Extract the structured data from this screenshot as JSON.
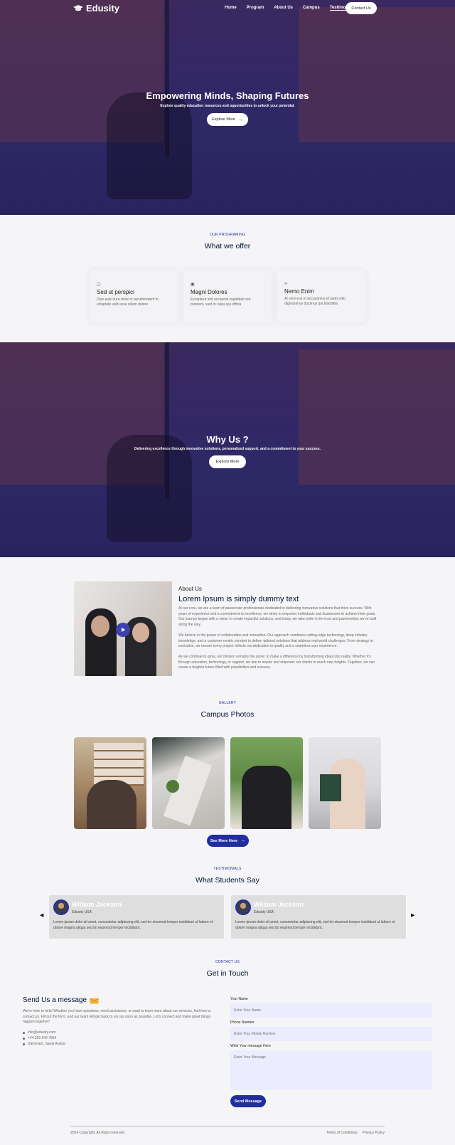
{
  "brand": {
    "name": "Edusity"
  },
  "nav": {
    "links": [
      "Home",
      "Program",
      "About Us",
      "Campus",
      "Testimonial"
    ],
    "contact_button": "Contact Us"
  },
  "hero": {
    "title": "Empowering Minds, Shaping Futures",
    "subtitle": "Explore quality education resources and opportunities to unlock your potential.",
    "button": "Explore More"
  },
  "programs": {
    "tag": "OUR PROGRAMING",
    "title": "What we offer",
    "cards": [
      {
        "icon": "grid-icon",
        "title": "Sed ut perspici",
        "text": "Duis aute irure dolor in reprehenderit in voluptate velit esse cillum dolore"
      },
      {
        "icon": "image-icon",
        "title": "Magni Dolores",
        "text": "Excepteur sint occaecat cupidatat non proident, sunt in culpa qui officia"
      },
      {
        "icon": "link-icon",
        "title": "Nemo Enim",
        "text": "At vero eos et accusamus et iusto odio dignissimos ducimus qui blanditiis"
      }
    ]
  },
  "why": {
    "title": "Why Us ?",
    "subtitle": "Delivering excellence through innovative solutions, personalized support, and a commitment to your success.",
    "button": "Explore More"
  },
  "about": {
    "tag": "About Us",
    "title": "Lorem Ipsum is simply dummy text",
    "paragraphs": [
      "At our core, we are a team of passionate professionals dedicated to delivering innovative solutions that drive success. With years of experience and a commitment to excellence, we strive to empower individuals and businesses to achieve their goals. Our journey began with a vision to create impactful solutions, and today, we take pride in the trust and partnerships we've built along the way.",
      "We believe in the power of collaboration and innovation. Our approach combines cutting-edge technology, deep industry knowledge, and a customer-centric mindset to deliver tailored solutions that address real-world challenges. From strategy to execution, we ensure every project reflects our dedication to quality and a seamless user experience.",
      "As we continue to grow, our mission remains the same: to make a difference by transforming ideas into reality. Whether it's through education, technology, or support, we aim to inspire and empower our clients to reach new heights. Together, we can create a brighter future filled with possibilities and success."
    ]
  },
  "gallery": {
    "tag": "GALLERY",
    "title": "Campus Photos",
    "button": "See More Here"
  },
  "testimonials": {
    "tag": "TESTIMONIALS",
    "title": "What Students Say",
    "items": [
      {
        "name": "William Jackson",
        "location": "Edusity USA",
        "text": "Lorem ipsum dolor sit amet, consectetur adipiscing elit, sed do eiusmod tempor incididunt ut labore et dolore magna aliqua sed do eiusmod tempor incididunt."
      },
      {
        "name": "William Jackson",
        "location": "Edusity USA",
        "text": "Lorem ipsum dolor sit amet, consectetur adipiscing elit, sed do eiusmod tempor incididunt ut labore et dolore magna aliqua sed do eiusmod tempor incididunt."
      }
    ]
  },
  "contact": {
    "tag": "CONTACT US",
    "title": "Get in Touch",
    "send_title": "Send Us a message",
    "intro": "We're here to help! Whether you have questions, need assistance, or want to learn more about our services, feel free to contact us. Fill out the form, and our team will get back to you as soon as possible. Let's connect and make great things happen together!",
    "details": [
      "info@edusity.com",
      "+44 203 542 7854",
      "Dammam, Saudi Arabia"
    ],
    "form": {
      "name_label": "Your Name",
      "name_placeholder": "Enter Your Name",
      "phone_label": "Phone Number",
      "phone_placeholder": "Enter Your Mobile Number",
      "message_label": "Write Your message Here",
      "message_placeholder": "Enter Your Message",
      "submit": "Send Message"
    }
  },
  "footer": {
    "copyright": "2024 Copyright, All Right reserved",
    "links": [
      "Terms of Conditions",
      "Privacy Policy"
    ]
  },
  "colors": {
    "primary": "#212ea0",
    "heading": "#000f38",
    "overlay": "#28206e"
  }
}
